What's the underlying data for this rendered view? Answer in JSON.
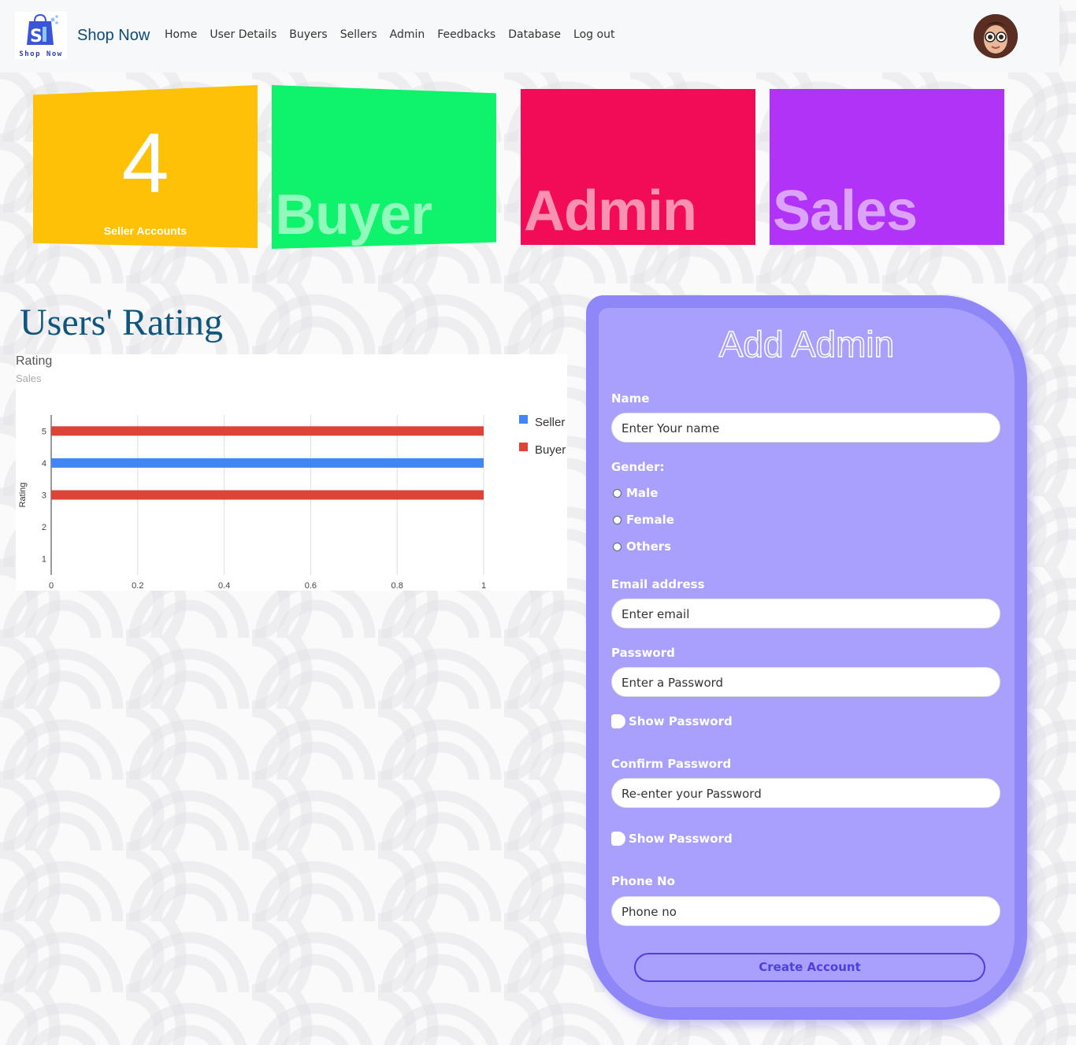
{
  "nav": {
    "logo_text": "Shop Now",
    "brand": "Shop Now",
    "links": [
      "Home",
      "User Details",
      "Buyers",
      "Sellers",
      "Admin",
      "Feedbacks",
      "Database",
      "Log out"
    ]
  },
  "cards": {
    "seller": {
      "count": "4",
      "label": "Seller Accounts",
      "color": "#ffc107"
    },
    "buyer": {
      "label": "Buyer",
      "color": "#0ff26b"
    },
    "admin": {
      "label": "Admin",
      "color": "#f20c58"
    },
    "sales": {
      "label": "Sales",
      "color": "#b133f7"
    }
  },
  "rating": {
    "heading": "Users' Rating"
  },
  "chart_data": {
    "type": "bar",
    "orientation": "horizontal",
    "title": "Rating",
    "subtitle": "Sales",
    "ylabel": "Rating",
    "xlabel": "",
    "xlim": [
      0,
      1
    ],
    "ylim": [
      0.5,
      5.5
    ],
    "x_ticks": [
      "0",
      "0.2",
      "0.4",
      "0.6",
      "0.8",
      "1"
    ],
    "y_ticks": [
      "1",
      "2",
      "3",
      "4",
      "5"
    ],
    "legend_position": "right",
    "series": [
      {
        "name": "Seller",
        "color": "#4285f4",
        "points": [
          {
            "rating": 4,
            "value": 1
          }
        ]
      },
      {
        "name": "Buyer",
        "color": "#db4437",
        "points": [
          {
            "rating": 5,
            "value": 1
          },
          {
            "rating": 3,
            "value": 1
          }
        ]
      }
    ]
  },
  "form": {
    "heading": "Add Admin",
    "name_label": "Name",
    "name_placeholder": "Enter Your name",
    "gender_label": "Gender:",
    "gender_options": [
      "Male",
      "Female",
      "Others"
    ],
    "email_label": "Email address",
    "email_placeholder": "Enter email",
    "password_label": "Password",
    "password_placeholder": "Enter a Password",
    "show_password_1": "Show Password",
    "confirm_label": "Confirm Password",
    "confirm_placeholder": "Re-enter your Password",
    "show_password_2": "Show Password",
    "phone_label": "Phone No",
    "phone_placeholder": "Phone no",
    "submit_label": "Create Account"
  }
}
